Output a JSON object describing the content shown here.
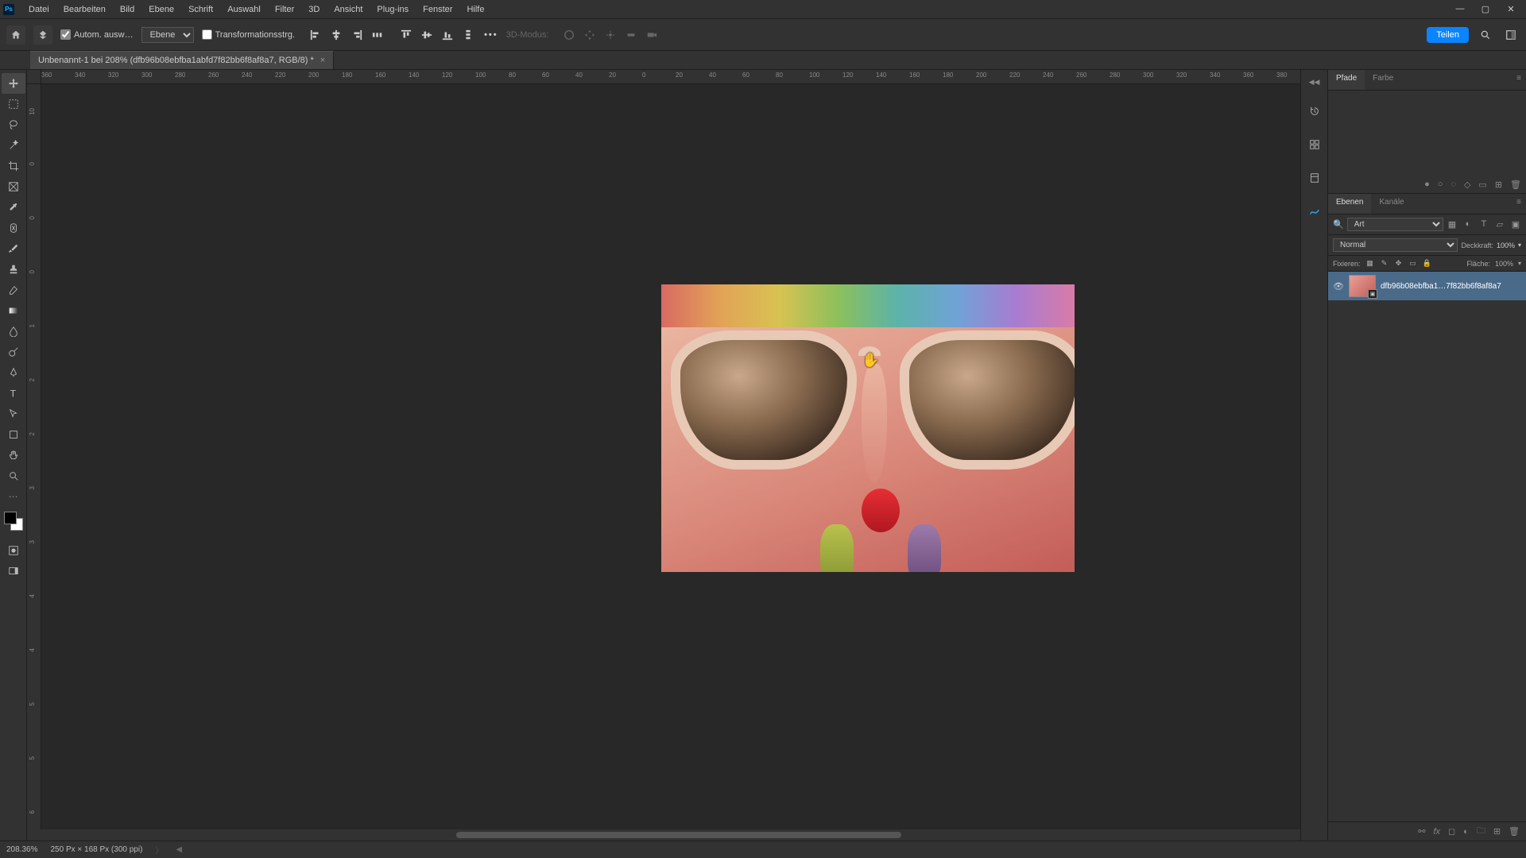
{
  "menu": [
    "Datei",
    "Bearbeiten",
    "Bild",
    "Ebene",
    "Schrift",
    "Auswahl",
    "Filter",
    "3D",
    "Ansicht",
    "Plug-ins",
    "Fenster",
    "Hilfe"
  ],
  "opt": {
    "auto_select_label": "Autom. ausw…",
    "layer_select": "Ebene",
    "transform_label": "Transformationsstrg.",
    "mode3d_label": "3D-Modus:",
    "share": "Teilen"
  },
  "doc": {
    "tab_title": "Unbenannt-1 bei 208% (dfb96b08ebfba1abfd7f82bb6f8af8a7, RGB/8) *"
  },
  "ruler_h": [
    "360",
    "340",
    "320",
    "300",
    "280",
    "260",
    "240",
    "220",
    "200",
    "180",
    "160",
    "140",
    "120",
    "100",
    "80",
    "60",
    "40",
    "20",
    "0",
    "20",
    "40",
    "60",
    "80",
    "100",
    "120",
    "140",
    "160",
    "180",
    "200",
    "220",
    "240",
    "260",
    "280",
    "300",
    "320",
    "340",
    "360",
    "380"
  ],
  "ruler_v": [
    "10",
    "0",
    "0",
    "0",
    "1",
    "2",
    "2",
    "3",
    "3",
    "4",
    "4",
    "5",
    "5",
    "6"
  ],
  "panel": {
    "tabs_top": [
      "Pfade",
      "Farbe"
    ],
    "tabs_layers": [
      "Ebenen",
      "Kanäle"
    ],
    "search_label": "Art",
    "blend_mode": "Normal",
    "opacity_label": "Deckkraft:",
    "opacity_val": "100%",
    "lock_label": "Fixieren:",
    "fill_label": "Fläche:",
    "fill_val": "100%",
    "layer_name": "dfb96b08ebfba1…7f82bb6f8af8a7"
  },
  "status": {
    "zoom": "208.36%",
    "info": "250 Px × 168 Px (300 ppi)"
  }
}
